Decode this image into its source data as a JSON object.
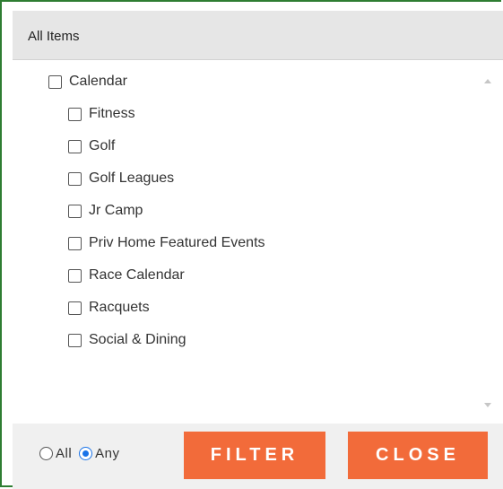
{
  "header": {
    "title": "All Items"
  },
  "tree": {
    "parent": {
      "label": "Calendar",
      "checked": false
    },
    "children": [
      {
        "label": "Fitness",
        "checked": false
      },
      {
        "label": "Golf",
        "checked": false
      },
      {
        "label": "Golf Leagues",
        "checked": false
      },
      {
        "label": "Jr Camp",
        "checked": false
      },
      {
        "label": "Priv Home Featured Events",
        "checked": false
      },
      {
        "label": "Race Calendar",
        "checked": false
      },
      {
        "label": "Racquets",
        "checked": false
      },
      {
        "label": "Social & Dining",
        "checked": false
      }
    ]
  },
  "match_mode": {
    "options": [
      {
        "label": "All",
        "selected": false
      },
      {
        "label": "Any",
        "selected": true
      }
    ]
  },
  "buttons": {
    "filter": "FILTER",
    "close": "CLOSE"
  },
  "colors": {
    "frame": "#2e7d32",
    "button": "#f26b3a",
    "radio_selected": "#1a73e8"
  }
}
